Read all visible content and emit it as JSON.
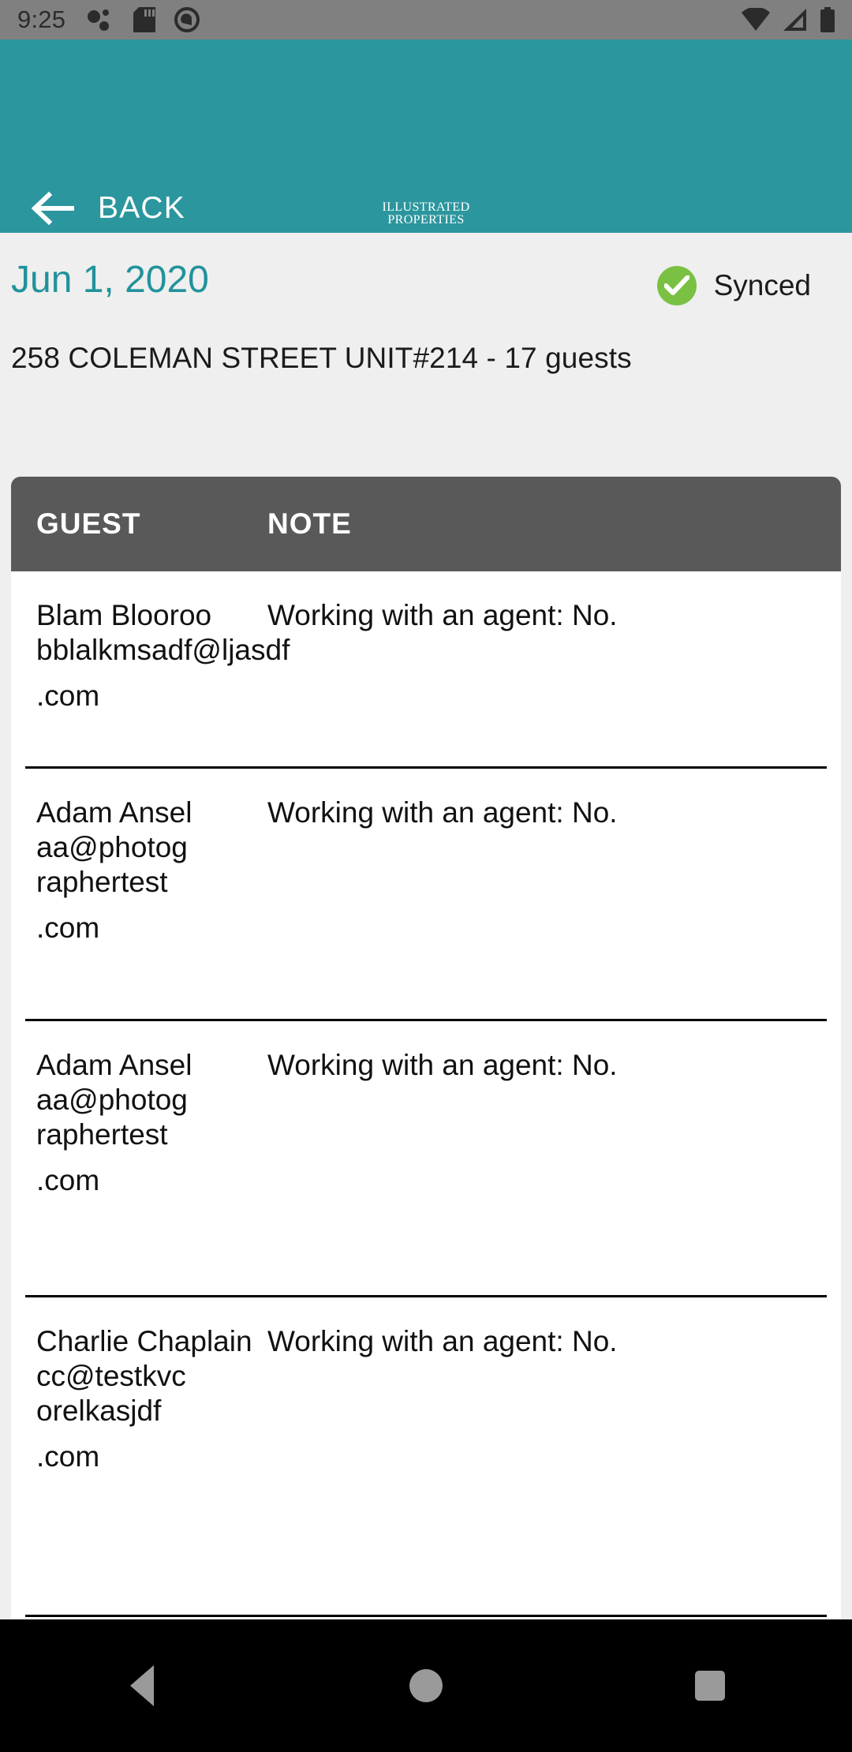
{
  "statusbar": {
    "time": "9:25",
    "left_icons": [
      "bubbles-icon",
      "sd-card-icon",
      "circle-q-icon"
    ],
    "right_icons": [
      "wifi-icon",
      "cellular-signal-icon",
      "battery-icon"
    ]
  },
  "appbar": {
    "back_label": "BACK",
    "back_icon": "arrow-left-icon",
    "logo_line1": "ILLUSTRATED",
    "logo_line2": "PROPERTIES",
    "background_color": "#2c969e"
  },
  "info": {
    "date": "Jun 1, 2020",
    "date_color": "#21929b",
    "sync_label": "Synced",
    "sync_icon": "check-circle-icon",
    "sync_color": "#7ac143",
    "address": "258 COLEMAN STREET UNIT#214 - 17 guests"
  },
  "table": {
    "columns": [
      "GUEST",
      "NOTE"
    ],
    "header_bg": "#595959",
    "rows": [
      {
        "name": "Blam Blooroo",
        "email_lines": [
          "bblalkmsadf@ljasdf",
          ".com"
        ],
        "note": "Working with an agent: No."
      },
      {
        "name": "Adam Ansel",
        "email_lines": [
          "aa@photog",
          "raphertest",
          ".com"
        ],
        "note": "Working with an agent: No."
      },
      {
        "name": "Adam Ansel",
        "email_lines": [
          "aa@photog",
          "raphertest",
          ".com"
        ],
        "note": "Working with an agent: No."
      },
      {
        "name": "Charlie Chaplain",
        "email_lines": [
          "cc@testkvc",
          "orelkasjdf",
          ".com"
        ],
        "note": "Working with an agent: No."
      }
    ]
  },
  "navbar": {
    "back": "nav-back-icon",
    "home": "nav-home-icon",
    "recents": "nav-recents-icon"
  }
}
